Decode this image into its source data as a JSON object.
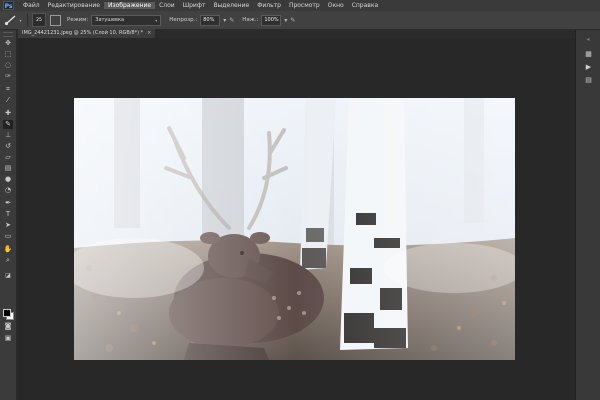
{
  "app": {
    "logo": "Ps"
  },
  "menubar": {
    "items": [
      "Файл",
      "Редактирование",
      "Изображение",
      "Слои",
      "Шрифт",
      "Выделение",
      "Фильтр",
      "Просмотр",
      "Окно",
      "Справка"
    ],
    "active_index": 2
  },
  "options": {
    "brush_size": "25",
    "mode_label": "Режим:",
    "mode_value": "Затушевка",
    "opacity_label": "Непрозр.:",
    "opacity_value": "80%",
    "flow_label": "Наж.:",
    "flow_value": "100%"
  },
  "document": {
    "tab_label": "IMG_24421231.jpeg @ 25% (Слой 10, RGB/8*) *",
    "close_glyph": "×"
  },
  "toolbar": {
    "tools": [
      "move-tool-icon",
      "marquee-tool-icon",
      "lasso-tool-icon",
      "quick-select-icon",
      "crop-tool-icon",
      "eyedropper-icon",
      "spot-healing-icon",
      "brush-tool-icon",
      "clone-stamp-icon",
      "history-brush-icon",
      "eraser-icon",
      "gradient-tool-icon",
      "blur-tool-icon",
      "dodge-tool-icon",
      "pen-tool-icon",
      "type-tool-icon",
      "path-select-icon",
      "shape-tool-icon",
      "hand-tool-icon",
      "zoom-tool-icon"
    ],
    "foreground_color": "#000000",
    "background_color": "#ffffff"
  },
  "rightpanel": {
    "buttons": [
      "history-panel-icon",
      "actions-panel-icon",
      "properties-panel-icon"
    ]
  },
  "colors": {
    "menubar": "#3a3a3a",
    "optionsbar": "#414141",
    "workspace": "#282828"
  }
}
